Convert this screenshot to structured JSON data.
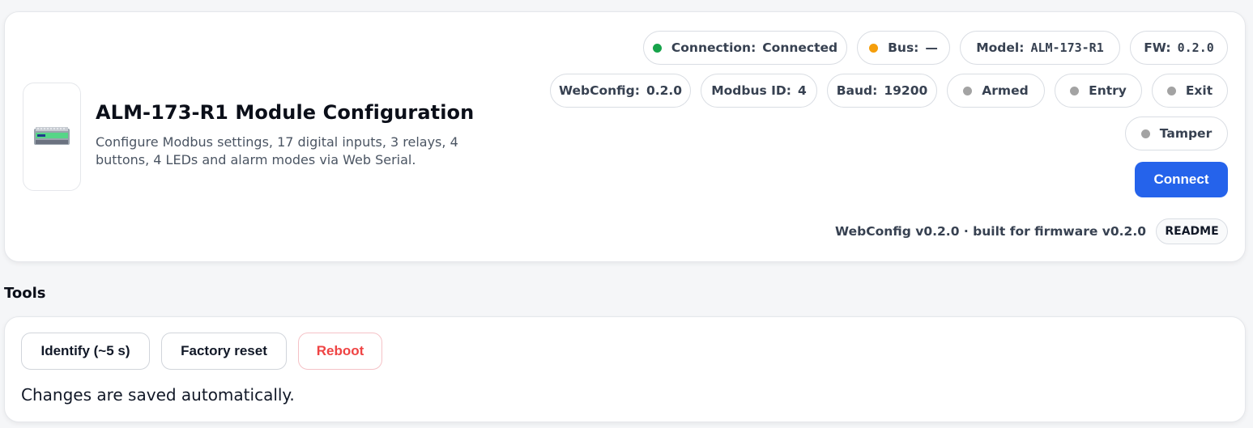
{
  "header": {
    "title": "ALM-173-R1 Module Configuration",
    "subtitle": "Configure Modbus settings, 17 digital inputs, 3 relays, 4 buttons, 4 LEDs and alarm modes via Web Serial.",
    "logo_icon": "din-rail-module-icon"
  },
  "status": {
    "connection": {
      "label": "Connection:",
      "value": "Connected",
      "dot_color": "#16a34a"
    },
    "bus": {
      "label": "Bus:",
      "value": "—",
      "dot_color": "#f59e0b"
    },
    "model": {
      "label": "Model:",
      "value": "ALM-173-R1"
    },
    "fw": {
      "label": "FW:",
      "value": "0.2.0"
    },
    "webconfig": {
      "label": "WebConfig:",
      "value": "0.2.0"
    },
    "modbus_id": {
      "label": "Modbus ID:",
      "value": "4"
    },
    "baud": {
      "label": "Baud:",
      "value": "19200"
    },
    "indicators": [
      {
        "label": "Armed",
        "dot_color": "#a3a3a3"
      },
      {
        "label": "Entry",
        "dot_color": "#a3a3a3"
      },
      {
        "label": "Exit",
        "dot_color": "#a3a3a3"
      },
      {
        "label": "Tamper",
        "dot_color": "#a3a3a3"
      }
    ]
  },
  "connect_button": {
    "label": "Connect",
    "color": "#2563eb"
  },
  "version_text": "WebConfig v0.2.0 · built for firmware v0.2.0",
  "readme_label": "README",
  "tools": {
    "title": "Tools",
    "buttons": [
      {
        "label": "Identify (~5 s)"
      },
      {
        "label": "Factory reset"
      },
      {
        "label": "Reboot",
        "color": "#ef4444"
      }
    ],
    "note": "Changes are saved automatically."
  }
}
